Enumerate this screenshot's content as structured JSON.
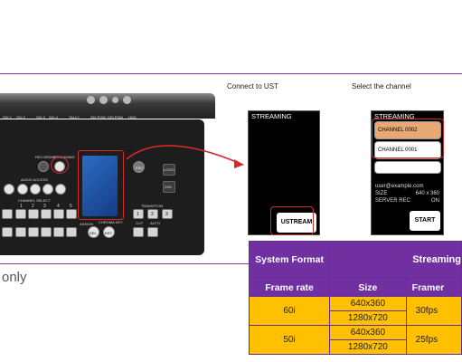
{
  "captions": {
    "connect": "Connect to UST",
    "select": "Select the channel"
  },
  "left_text": "only",
  "device_labels": {
    "top": [
      "SDI 1",
      "SDI 2",
      "SDI 3",
      "SDI 4",
      "TALLY",
      "SDI PGM",
      "SDI PGM",
      "HDD"
    ],
    "recording": "RECORDING",
    "streaming": "STREAMING",
    "audio_access": "AUDIO ACCESS",
    "channel_select": "CHANNEL SELECT",
    "channel_numbers": [
      "1",
      "2",
      "3",
      "4",
      "5"
    ],
    "transition": "TRANSITION",
    "cut": "CUT",
    "auto": "AUTO",
    "assign": "ASSIGN",
    "logo": "LOGO",
    "dsk": "DSK",
    "esc": "ESC",
    "chromakey": "CHROMA KEY",
    "key": "KEY",
    "del": "DEL",
    "trans_nums": [
      "1",
      "2",
      "3"
    ]
  },
  "phone1": {
    "title": "STREAMING",
    "button": "USTREAM"
  },
  "phone2": {
    "title": "STREAMING",
    "channels": [
      "CHANNEL 0002",
      "CHANNEL 0001"
    ],
    "user": "user@example.com",
    "size_label": "SIZE",
    "size_value": "640 x 360",
    "rec_label": "SERVER REC",
    "rec_value": "ON",
    "start": "START"
  },
  "table": {
    "header_format": "System Format",
    "header_streaming": "Streaming",
    "col_frame_rate": "Frame rate",
    "col_size": "Size",
    "col_framerate": "Framer",
    "rows": [
      {
        "frame_rate": "60i",
        "sizes": [
          "640x360",
          "1280x720"
        ],
        "fps": "30fps"
      },
      {
        "frame_rate": "50i",
        "sizes": [
          "640x360",
          "1280x720"
        ],
        "fps": "25fps"
      }
    ]
  },
  "colors": {
    "accent_purple": "#7030a0",
    "table_yellow": "#ffc000",
    "highlight_red": "#d42a2a",
    "channel_selected": "#e8a873"
  }
}
